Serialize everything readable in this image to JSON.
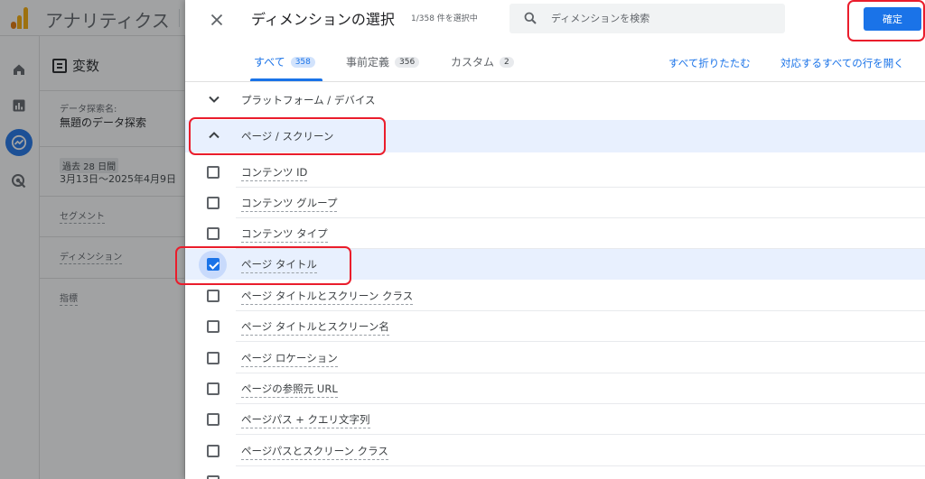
{
  "app": {
    "name": "アナリティクス",
    "variables": {
      "title": "変数",
      "exploration_label": "データ探索名:",
      "exploration_name": "無題のデータ探索",
      "date_chip": "過去 28 日間",
      "date_range": "3月13日～2025年4月9日",
      "segments": "セグメント",
      "dimensions": "ディメンション",
      "metrics": "指標"
    }
  },
  "panel": {
    "title": "ディメンションの選択",
    "count": "1/358 件を選択中",
    "search_placeholder": "ディメンションを検索",
    "confirm_label": "確定",
    "tabs": [
      {
        "label": "すべて",
        "count": "358",
        "active": true
      },
      {
        "label": "事前定義",
        "count": "356",
        "active": false
      },
      {
        "label": "カスタム",
        "count": "2",
        "active": false
      }
    ],
    "collapse_all": "すべて折りたたむ",
    "expand_matching": "対応するすべての行を開く",
    "groups": [
      {
        "label": "プラットフォーム / デバイス",
        "expanded": false
      },
      {
        "label": "ページ / スクリーン",
        "expanded": true
      }
    ],
    "items": [
      {
        "label": "コンテンツ ID",
        "checked": false
      },
      {
        "label": "コンテンツ グループ",
        "checked": false
      },
      {
        "label": "コンテンツ タイプ",
        "checked": false
      },
      {
        "label": "ページ タイトル",
        "checked": true
      },
      {
        "label": "ページ タイトルとスクリーン クラス",
        "checked": false
      },
      {
        "label": "ページ タイトルとスクリーン名",
        "checked": false
      },
      {
        "label": "ページ ロケーション",
        "checked": false
      },
      {
        "label": "ページの参照元 URL",
        "checked": false
      },
      {
        "label": "ページパス + クエリ文字列",
        "checked": false
      },
      {
        "label": "ページパスとスクリーン クラス",
        "checked": false
      }
    ]
  },
  "colors": {
    "accent": "#1a73e8",
    "highlight": "#ea1d2c",
    "selected_row": "#e8f0fe"
  }
}
